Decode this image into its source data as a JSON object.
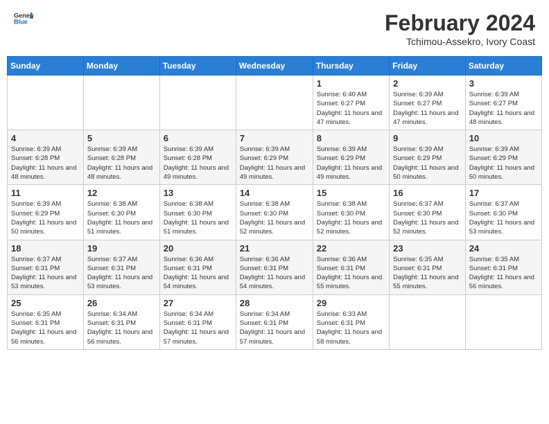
{
  "header": {
    "logo_general": "General",
    "logo_blue": "Blue",
    "month_year": "February 2024",
    "location": "Tchimou-Assekro, Ivory Coast"
  },
  "days_of_week": [
    "Sunday",
    "Monday",
    "Tuesday",
    "Wednesday",
    "Thursday",
    "Friday",
    "Saturday"
  ],
  "weeks": [
    [
      {
        "day": "",
        "info": ""
      },
      {
        "day": "",
        "info": ""
      },
      {
        "day": "",
        "info": ""
      },
      {
        "day": "",
        "info": ""
      },
      {
        "day": "1",
        "info": "Sunrise: 6:40 AM\nSunset: 6:27 PM\nDaylight: 11 hours and 47 minutes."
      },
      {
        "day": "2",
        "info": "Sunrise: 6:39 AM\nSunset: 6:27 PM\nDaylight: 11 hours and 47 minutes."
      },
      {
        "day": "3",
        "info": "Sunrise: 6:39 AM\nSunset: 6:27 PM\nDaylight: 11 hours and 48 minutes."
      }
    ],
    [
      {
        "day": "4",
        "info": "Sunrise: 6:39 AM\nSunset: 6:28 PM\nDaylight: 11 hours and 48 minutes."
      },
      {
        "day": "5",
        "info": "Sunrise: 6:39 AM\nSunset: 6:28 PM\nDaylight: 11 hours and 48 minutes."
      },
      {
        "day": "6",
        "info": "Sunrise: 6:39 AM\nSunset: 6:28 PM\nDaylight: 11 hours and 49 minutes."
      },
      {
        "day": "7",
        "info": "Sunrise: 6:39 AM\nSunset: 6:29 PM\nDaylight: 11 hours and 49 minutes."
      },
      {
        "day": "8",
        "info": "Sunrise: 6:39 AM\nSunset: 6:29 PM\nDaylight: 11 hours and 49 minutes."
      },
      {
        "day": "9",
        "info": "Sunrise: 6:39 AM\nSunset: 6:29 PM\nDaylight: 11 hours and 50 minutes."
      },
      {
        "day": "10",
        "info": "Sunrise: 6:39 AM\nSunset: 6:29 PM\nDaylight: 11 hours and 50 minutes."
      }
    ],
    [
      {
        "day": "11",
        "info": "Sunrise: 6:39 AM\nSunset: 6:29 PM\nDaylight: 11 hours and 50 minutes."
      },
      {
        "day": "12",
        "info": "Sunrise: 6:38 AM\nSunset: 6:30 PM\nDaylight: 11 hours and 51 minutes."
      },
      {
        "day": "13",
        "info": "Sunrise: 6:38 AM\nSunset: 6:30 PM\nDaylight: 11 hours and 51 minutes."
      },
      {
        "day": "14",
        "info": "Sunrise: 6:38 AM\nSunset: 6:30 PM\nDaylight: 11 hours and 52 minutes."
      },
      {
        "day": "15",
        "info": "Sunrise: 6:38 AM\nSunset: 6:30 PM\nDaylight: 11 hours and 52 minutes."
      },
      {
        "day": "16",
        "info": "Sunrise: 6:37 AM\nSunset: 6:30 PM\nDaylight: 11 hours and 52 minutes."
      },
      {
        "day": "17",
        "info": "Sunrise: 6:37 AM\nSunset: 6:30 PM\nDaylight: 11 hours and 53 minutes."
      }
    ],
    [
      {
        "day": "18",
        "info": "Sunrise: 6:37 AM\nSunset: 6:31 PM\nDaylight: 11 hours and 53 minutes."
      },
      {
        "day": "19",
        "info": "Sunrise: 6:37 AM\nSunset: 6:31 PM\nDaylight: 11 hours and 53 minutes."
      },
      {
        "day": "20",
        "info": "Sunrise: 6:36 AM\nSunset: 6:31 PM\nDaylight: 11 hours and 54 minutes."
      },
      {
        "day": "21",
        "info": "Sunrise: 6:36 AM\nSunset: 6:31 PM\nDaylight: 11 hours and 54 minutes."
      },
      {
        "day": "22",
        "info": "Sunrise: 6:36 AM\nSunset: 6:31 PM\nDaylight: 11 hours and 55 minutes."
      },
      {
        "day": "23",
        "info": "Sunrise: 6:35 AM\nSunset: 6:31 PM\nDaylight: 11 hours and 55 minutes."
      },
      {
        "day": "24",
        "info": "Sunrise: 6:35 AM\nSunset: 6:31 PM\nDaylight: 11 hours and 56 minutes."
      }
    ],
    [
      {
        "day": "25",
        "info": "Sunrise: 6:35 AM\nSunset: 6:31 PM\nDaylight: 11 hours and 56 minutes."
      },
      {
        "day": "26",
        "info": "Sunrise: 6:34 AM\nSunset: 6:31 PM\nDaylight: 11 hours and 56 minutes."
      },
      {
        "day": "27",
        "info": "Sunrise: 6:34 AM\nSunset: 6:31 PM\nDaylight: 11 hours and 57 minutes."
      },
      {
        "day": "28",
        "info": "Sunrise: 6:34 AM\nSunset: 6:31 PM\nDaylight: 11 hours and 57 minutes."
      },
      {
        "day": "29",
        "info": "Sunrise: 6:33 AM\nSunset: 6:31 PM\nDaylight: 11 hours and 58 minutes."
      },
      {
        "day": "",
        "info": ""
      },
      {
        "day": "",
        "info": ""
      }
    ]
  ]
}
